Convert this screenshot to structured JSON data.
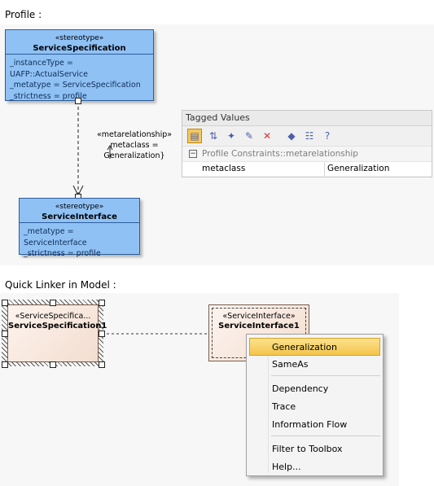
{
  "profile": {
    "section_label": "Profile :",
    "service_specification": {
      "stereotype": "«stereotype»",
      "name": "ServiceSpecification",
      "attributes": [
        "_instanceType = UAFP::ActualService",
        "_metatype = ServiceSpecification",
        "_strictness = profile"
      ]
    },
    "service_interface": {
      "stereotype": "«stereotype»",
      "name": "ServiceInterface",
      "attributes": [
        "_metatype = ServiceInterface",
        "_strictness = profile"
      ]
    },
    "connector_label": [
      "«metarelationship»",
      "metaclass =",
      "Generalization}"
    ]
  },
  "tagged_values": {
    "title": "Tagged Values",
    "toolbar_icons": [
      "categorized-icon",
      "sort-icon",
      "add-tag-icon",
      "edit-icon",
      "delete-icon",
      "tag-icon",
      "filter-icon",
      "help-icon"
    ],
    "group": {
      "toggle": "−",
      "label": "Profile Constraints::metarelationship"
    },
    "rows": [
      {
        "name": "metaclass",
        "value": "Generalization"
      }
    ]
  },
  "quick_linker": {
    "section_label": "Quick Linker in Model :",
    "source": {
      "stereotype": "«ServiceSpecifica...",
      "name": "ServiceSpecification1"
    },
    "target": {
      "stereotype": "«ServiceInterface»",
      "name": "ServiceInterface1"
    },
    "menu": {
      "items": [
        "Generalization",
        "SameAs",
        "Dependency",
        "Trace",
        "Information Flow",
        "Filter to Toolbox",
        "Help..."
      ],
      "highlighted": "Generalization"
    }
  },
  "colors": {
    "class_fill": "#8fc1f5",
    "class_border": "#2c5d9a",
    "menu_highlight": "#f6c85a"
  }
}
